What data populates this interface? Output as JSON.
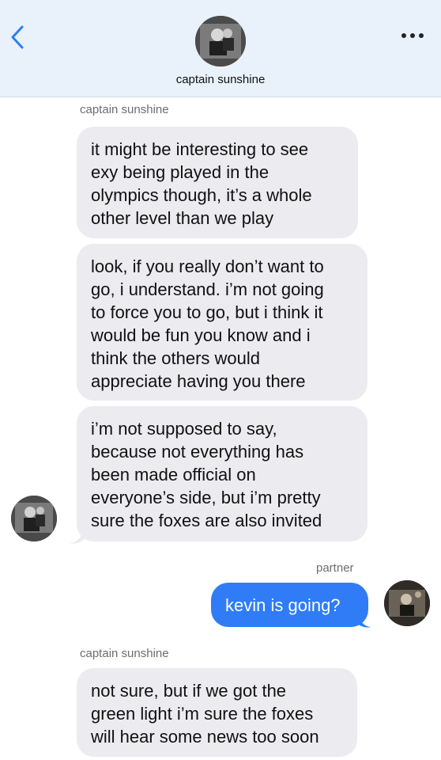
{
  "header": {
    "contact_name": "captain sunshine",
    "icons": {
      "back": "chevron-left-icon",
      "more": "more-dots-icon"
    }
  },
  "messages": [
    {
      "sender": "captain sunshine",
      "text": "it might be interesting to see exy being played in the olympics though, it’s a whole other level than we play",
      "lines": [
        "it might be interesting to see",
        "exy being played in the",
        "olympics though, it’s a whole",
        "other level than we play"
      ]
    },
    {
      "text": "look, if you really don’t want to go, i understand. i’m not going to force you to go, but i think it would be fun you know and i think the others would appreciate having you there",
      "lines": [
        "look, if you really don’t want to",
        "go, i understand. i’m not going",
        "to force you to go, but i think it",
        "would be fun you know and i",
        "think the others would",
        "appreciate having you there"
      ]
    },
    {
      "text": "i’m not supposed to say, because not everything has been made official on everyone’s side, but i’m pretty sure the foxes are also invited",
      "lines": [
        "i’m not supposed to say,",
        "because not everything has",
        "been made official on",
        "everyone’s side, but i’m pretty",
        "sure the foxes are also invited"
      ]
    },
    {
      "sender": "partner",
      "text": "kevin is going?",
      "lines": [
        "kevin is going?"
      ]
    },
    {
      "sender": "captain sunshine",
      "text": "not sure, but if we got the green light i’m sure the foxes will hear some news too soon",
      "lines": [
        "not sure, but if we got the",
        "green light i’m sure the foxes",
        "will hear some news too soon"
      ]
    }
  ],
  "colors": {
    "incoming_bubble": "#ebebf0",
    "outgoing_bubble": "#2f7cf6",
    "header_bg": "#e9f1fb",
    "accent": "#2f7cf6"
  }
}
